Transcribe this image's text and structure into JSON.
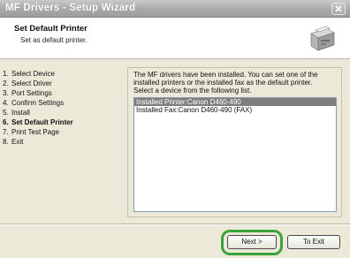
{
  "window": {
    "title": "MF Drivers - Setup Wizard"
  },
  "header": {
    "title": "Set Default Printer",
    "subtitle": "Set as default printer.",
    "graphic_icon": "printer-icon"
  },
  "steps": [
    {
      "num": "1.",
      "label": "Select Device",
      "active": false
    },
    {
      "num": "2.",
      "label": "Select Driver",
      "active": false
    },
    {
      "num": "3.",
      "label": "Port Settings",
      "active": false
    },
    {
      "num": "4.",
      "label": "Confirm Settings",
      "active": false
    },
    {
      "num": "5.",
      "label": "Install",
      "active": false
    },
    {
      "num": "6.",
      "label": "Set Default Printer",
      "active": true
    },
    {
      "num": "7.",
      "label": "Print Test Page",
      "active": false
    },
    {
      "num": "8.",
      "label": "Exit",
      "active": false
    }
  ],
  "main": {
    "description_lines": [
      "The MF drivers have been installed. You can set one of the",
      "installed printers or the installed fax as the default printer.",
      "Select a device from the following list."
    ],
    "devices": [
      {
        "label": "Installed Printer:Canon D460-490",
        "selected": true
      },
      {
        "label": "Installed Fax:Canon D460-490 (FAX)",
        "selected": false
      }
    ]
  },
  "buttons": {
    "next_label": "Next >",
    "exit_label": "To Exit"
  },
  "colors": {
    "highlight": "#3ba33b",
    "selection": "#7e7e7e"
  }
}
